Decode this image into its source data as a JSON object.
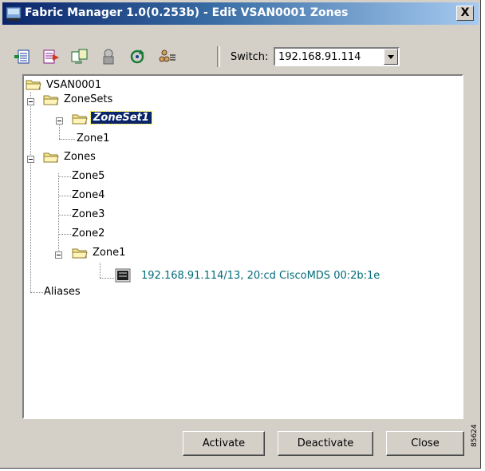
{
  "window": {
    "title": "Fabric Manager 1.0(0.253b) - Edit VSAN0001 Zones",
    "close_glyph": "X"
  },
  "toolbar": {
    "tools": [
      "insert-zone-icon",
      "add-member-icon",
      "copy-zoneset-icon",
      "clear-zone-icon",
      "refresh-icon",
      "show-members-icon"
    ],
    "switch_label": "Switch:",
    "switch_value": "192.168.91.114"
  },
  "tree": {
    "root": "VSAN0001",
    "zonesets_label": "ZoneSets",
    "zoneset1_label": "ZoneSet1",
    "zoneset1_member": "Zone1",
    "zones_label": "Zones",
    "zone_items": [
      "Zone5",
      "Zone4",
      "Zone3",
      "Zone2"
    ],
    "zone1_label": "Zone1",
    "device_label": "192.168.91.114/13, 20:cd CiscoMDS 00:2b:1e",
    "aliases_label": "Aliases"
  },
  "buttons": {
    "activate": "Activate",
    "deactivate": "Deactivate",
    "close": "Close"
  },
  "figure_id": "85624",
  "colors": {
    "title_bar_start": "#0a246a",
    "title_bar_end": "#a6caf0",
    "window_face": "#d4d0c8",
    "selection": "#0a246a",
    "device_text": "#006b7a"
  }
}
